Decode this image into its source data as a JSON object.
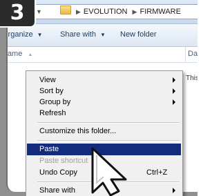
{
  "step_number": "3",
  "address": {
    "crumbs": [
      "EVOLUTION",
      "FIRMWARE"
    ],
    "separator_icon": "chevron-right-icon"
  },
  "toolbar": {
    "organize_label": "Organize",
    "share_label": "Share with",
    "new_folder_label": "New folder"
  },
  "columns": {
    "name": "Name",
    "date": "Date"
  },
  "empty_text": "This",
  "context_menu": {
    "view": "View",
    "sort_by": "Sort by",
    "group_by": "Group by",
    "refresh": "Refresh",
    "customize": "Customize this folder...",
    "paste": "Paste",
    "paste_shortcut": "Paste shortcut",
    "undo_copy": "Undo Copy",
    "undo_copy_shortcut": "Ctrl+Z",
    "share_with": "Share with"
  },
  "colors": {
    "selection": "#122b7c",
    "badge": "#2b2b2b"
  }
}
